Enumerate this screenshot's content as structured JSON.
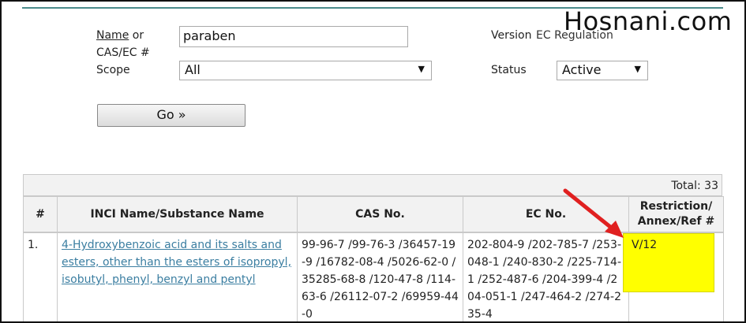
{
  "watermark": "Hosnani.com",
  "form": {
    "name_label": "Name",
    "name_label_rest": " or",
    "cas_label": "CAS/EC #",
    "name_value": "paraben",
    "scope_label": "Scope",
    "scope_value": "All",
    "version_label": "Version",
    "version_value": "EC Regulation",
    "status_label": "Status",
    "status_value": "Active",
    "go_label": "Go »"
  },
  "results": {
    "total_text": "Total: 33",
    "columns": [
      "#",
      "INCI Name/Substance Name",
      "CAS No.",
      "EC No.",
      "Restriction/ Annex/Ref #"
    ],
    "rows": [
      {
        "num": "1.",
        "name": "4-Hydroxybenzoic acid and its salts and esters, other than the esters of isopropyl, isobutyl, phenyl, benzyl and pentyl",
        "cas": "99-96-7 /99-76-3 /36457-19-9 /16782-08-4 /5026-62-0 /35285-68-8 /120-47-8 /114-63-6 /26112-07-2 /69959-44-0",
        "ec": "202-804-9 /202-785-7 /253-048-1 /240-830-2 /225-714-1 /252-487-6 /204-399-4 /204-051-1 /247-464-2 /274-235-4",
        "restriction": "V/12"
      }
    ]
  },
  "colors": {
    "accent_line": "#4b8c8c",
    "link": "#3b7ea1",
    "highlight": "#ffff00",
    "arrow": "#e02020"
  }
}
